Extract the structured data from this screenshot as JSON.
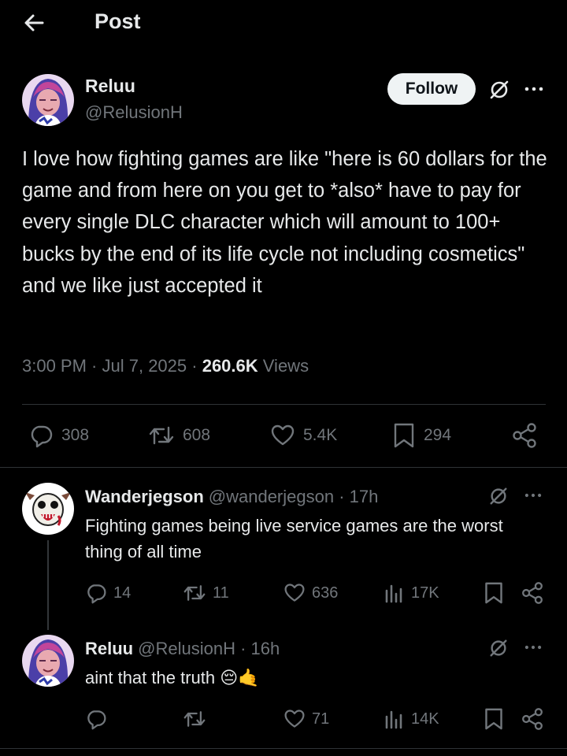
{
  "header": {
    "title": "Post",
    "back_icon": "arrow-left-icon"
  },
  "post": {
    "author_name": "Reluu",
    "author_handle": "@RelusionH",
    "follow_label": "Follow",
    "text": "I love how fighting games are like \"here is 60 dollars for the game and from here on you get to *also* have to pay for every single DLC character which will amount to 100+ bucks by the end of its life cycle not including cosmetics\" and we like just accepted it",
    "time": "3:00 PM",
    "date": "Jul 7, 2025",
    "views_count": "260.6K",
    "views_label": "Views",
    "stats": {
      "replies": "308",
      "reposts": "608",
      "likes": "5.4K",
      "bookmarks": "294"
    }
  },
  "replies": [
    {
      "name": "Wanderjegson",
      "handle": "@wanderjegson",
      "time": "17h",
      "text": "Fighting games being live service games are the worst thing of all time",
      "stats": {
        "replies": "14",
        "reposts": "11",
        "likes": "636",
        "views": "17K"
      }
    },
    {
      "name": "Reluu",
      "handle": "@RelusionH",
      "time": "16h",
      "text": "aint that the truth",
      "emoji": "😔🤙",
      "stats": {
        "likes": "71",
        "views": "14K"
      }
    }
  ],
  "separator": " · ",
  "colors": {
    "background": "#000000",
    "text": "#e7e9ea",
    "muted": "#71767b",
    "divider": "#2f3336",
    "follow_bg": "#eff3f4"
  }
}
